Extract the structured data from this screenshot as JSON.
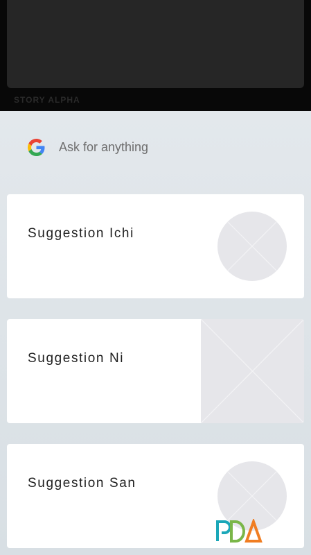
{
  "story": {
    "label": "STORY ALPHA"
  },
  "search": {
    "placeholder": "Ask for anything",
    "icon": "google-g-icon"
  },
  "suggestions": [
    {
      "title": "Suggestion Ichi",
      "thumbnail": "circle-placeholder-icon"
    },
    {
      "title": "Suggestion Ni",
      "thumbnail": "square-placeholder-icon"
    },
    {
      "title": "Suggestion San",
      "thumbnail": "circle-placeholder-icon"
    }
  ],
  "colors": {
    "story_bg": "#080808",
    "story_card": "#262626",
    "feed_bg": "#dfe5e9",
    "card_bg": "#ffffff",
    "placeholder": "#e6e6ea"
  }
}
